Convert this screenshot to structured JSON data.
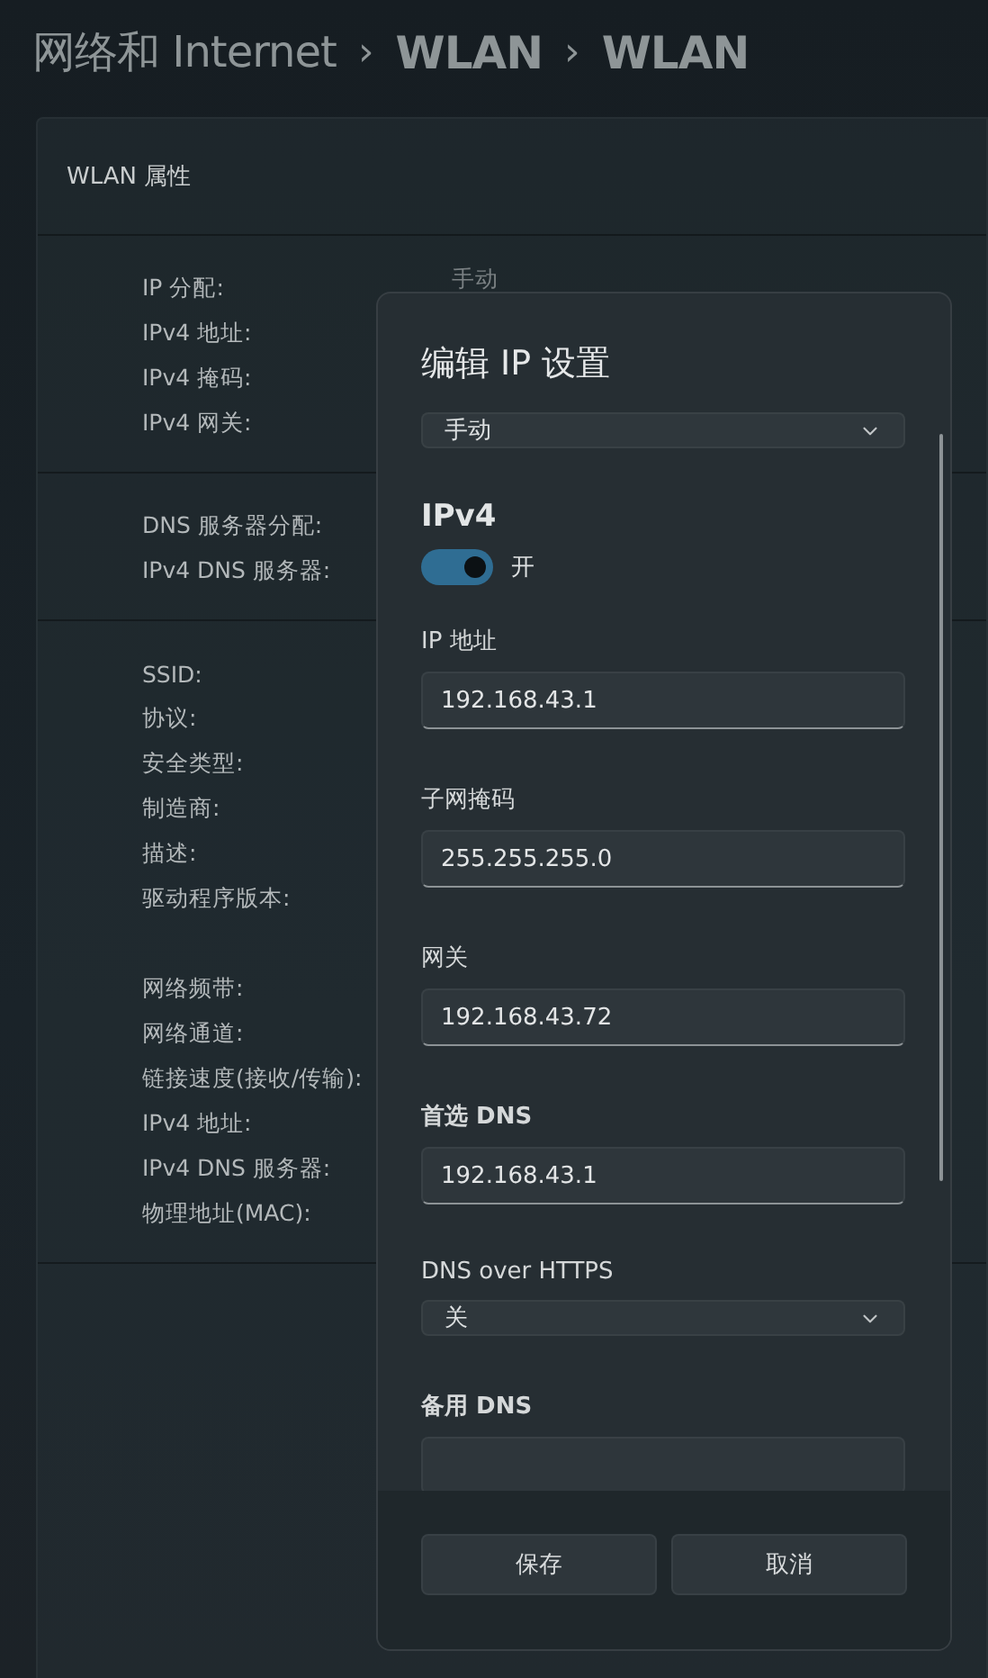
{
  "breadcrumb": [
    {
      "label": "网络和 Internet"
    },
    {
      "label": "WLAN"
    },
    {
      "label": "WLAN"
    }
  ],
  "breadcrumb_separator": "›",
  "properties_card": {
    "title": "WLAN 属性",
    "sections": [
      {
        "rows": [
          {
            "kind": "property",
            "label": "IP 分配:",
            "value": "手动"
          },
          {
            "kind": "property",
            "label": "IPv4 地址:"
          },
          {
            "kind": "property",
            "label": "IPv4 掩码:"
          },
          {
            "kind": "property",
            "label": "IPv4 网关:"
          }
        ]
      },
      {
        "rows": [
          {
            "kind": "property",
            "label": "DNS 服务器分配:"
          },
          {
            "kind": "property",
            "label": "IPv4 DNS 服务器:"
          }
        ]
      },
      {
        "rows": [
          {
            "kind": "property",
            "label": "SSID:"
          },
          {
            "kind": "property",
            "label": "协议:"
          },
          {
            "kind": "property",
            "label": "安全类型:"
          },
          {
            "kind": "property",
            "label": "制造商:"
          },
          {
            "kind": "property",
            "label": "描述:"
          },
          {
            "kind": "property",
            "label": "驱动程序版本:"
          },
          {
            "kind": "blank"
          },
          {
            "kind": "property",
            "label": "网络频带:"
          },
          {
            "kind": "property",
            "label": "网络通道:"
          },
          {
            "kind": "property",
            "label": "链接速度(接收/传输):"
          },
          {
            "kind": "property",
            "label": "IPv4 地址:"
          },
          {
            "kind": "property",
            "label": "IPv4 DNS 服务器:"
          },
          {
            "kind": "property",
            "label": "物理地址(MAC):"
          }
        ]
      }
    ]
  },
  "dialog": {
    "title": "编辑 IP 设置",
    "mode_select": {
      "value": "手动"
    },
    "section_title": "IPv4",
    "toggle": {
      "on": true,
      "label": "开"
    },
    "fields": [
      {
        "kind": "input",
        "label": "IP 地址",
        "value": "192.168.43.1",
        "bold": false
      },
      {
        "kind": "input",
        "label": "子网掩码",
        "value": "255.255.255.0",
        "bold": false
      },
      {
        "kind": "input",
        "label": "网关",
        "value": "192.168.43.72",
        "bold": false
      },
      {
        "kind": "input",
        "label": "首选 DNS",
        "value": "192.168.43.1",
        "bold": true
      },
      {
        "kind": "select",
        "label": "DNS over HTTPS",
        "value": "关",
        "bold": false
      },
      {
        "kind": "input",
        "label": "备用 DNS",
        "bold": true
      }
    ],
    "buttons": [
      {
        "label": "保存"
      },
      {
        "label": "取消"
      }
    ]
  }
}
